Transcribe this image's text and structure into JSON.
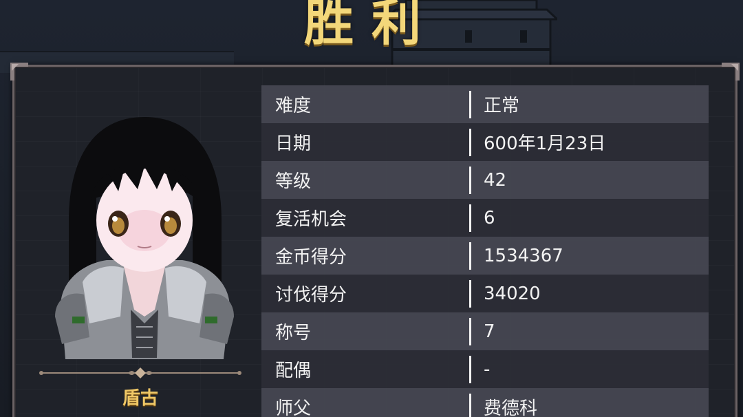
{
  "title": "胜利",
  "character": {
    "name": "盾古"
  },
  "stats": [
    {
      "label": "难度",
      "value": "正常"
    },
    {
      "label": "日期",
      "value": "600年1月23日"
    },
    {
      "label": "等级",
      "value": "42"
    },
    {
      "label": "复活机会",
      "value": "6"
    },
    {
      "label": "金币得分",
      "value": "1534367"
    },
    {
      "label": "讨伐得分",
      "value": "34020"
    },
    {
      "label": "称号",
      "value": "7"
    },
    {
      "label": "配偶",
      "value": "-"
    },
    {
      "label": "师父",
      "value": "费德科"
    }
  ],
  "colors": {
    "title_gold": "#f3d77a",
    "name_gold": "#f0c866",
    "panel_border": "#6b6264",
    "row_light": "#464852",
    "row_dark": "#2c2e36"
  }
}
